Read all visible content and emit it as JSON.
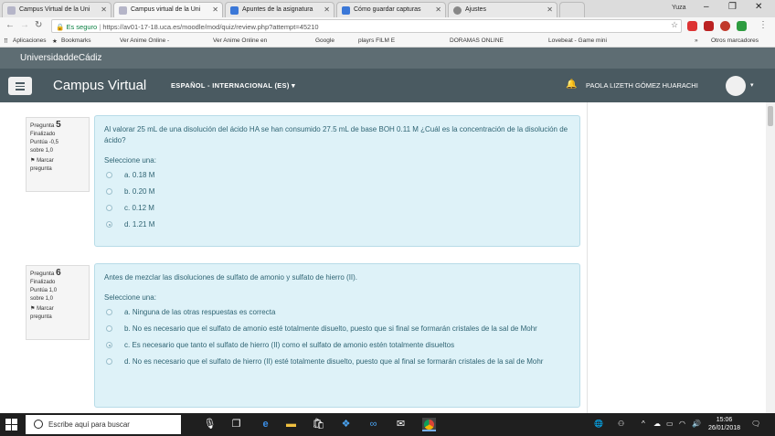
{
  "browser": {
    "tabs": [
      {
        "label": "Campus Virtual de la Uni"
      },
      {
        "label": "Campus virtual de la Uni"
      },
      {
        "label": "Apuntes de la asignatura"
      },
      {
        "label": "Cómo guardar capturas"
      },
      {
        "label": "Ajustes"
      }
    ],
    "user": "Yuza",
    "url_secure": "Es seguro",
    "url": "https://av01-17-18.uca.es/moodle/mod/quiz/review.php?attempt=45210",
    "bookmarks": [
      {
        "label": "Aplicaciones"
      },
      {
        "label": "Bookmarks"
      },
      {
        "label": "Ver Anime Online -"
      },
      {
        "label": "Ver Anime Online en"
      },
      {
        "label": "Google"
      },
      {
        "label": "playrs FILM E"
      },
      {
        "label": "DORAMAS ONLINE"
      },
      {
        "label": "Lovebeat - Game mini"
      }
    ],
    "other_bookmarks": "Otros marcadores"
  },
  "site": {
    "university": "UniversidaddeCádiz",
    "title": "Campus Virtual",
    "language": "ESPAÑOL - INTERNACIONAL (ES)",
    "user_name": "PAOLA LIZETH GÓMEZ HUARACHI"
  },
  "questions": [
    {
      "label": "Pregunta",
      "number": "5",
      "status": "Finalizado",
      "score_line1": "Puntúa -0,5",
      "score_line2": "sobre 1,0",
      "flag": "Marcar",
      "flag2": "pregunta",
      "text": "Al valorar 25 mL de una disolución del ácido HA se han consumido 27.5 mL de base BOH 0.11 M ¿Cuál es la concentración de la disolución de ácido?",
      "prompt": "Seleccione una:",
      "answers": [
        {
          "text": "a. 0.18 M",
          "checked": false
        },
        {
          "text": "b. 0.20 M",
          "checked": false
        },
        {
          "text": "c. 0.12 M",
          "checked": false
        },
        {
          "text": "d. 1.21 M",
          "checked": true
        }
      ]
    },
    {
      "label": "Pregunta",
      "number": "6",
      "status": "Finalizado",
      "score_line1": "Puntúa 1,0",
      "score_line2": "sobre 1,0",
      "flag": "Marcar",
      "flag2": "pregunta",
      "text": "Antes de mezclar las disoluciones de sulfato de amonio y sulfato de hierro (II).",
      "prompt": "Seleccione una:",
      "answers": [
        {
          "text": "a. Ninguna de las otras respuestas es correcta",
          "checked": false
        },
        {
          "text": "b. No es necesario que el sulfato de amonio esté totalmente disuelto, puesto que si final se formarán cristales de la sal de Mohr",
          "checked": false
        },
        {
          "text": "c. Es necesario que tanto el sulfato de hierro (II) como el sulfato de amonio estén totalmente disueltos",
          "checked": true
        },
        {
          "text": "d. No es necesario que el sulfato de hierro (II) esté totalmente disuelto, puesto que al final se formarán cristales de la sal de Mohr",
          "checked": false
        }
      ]
    }
  ],
  "taskbar": {
    "search_placeholder": "Escribe aquí para buscar",
    "time": "15:06",
    "date": "26/01/2018"
  }
}
